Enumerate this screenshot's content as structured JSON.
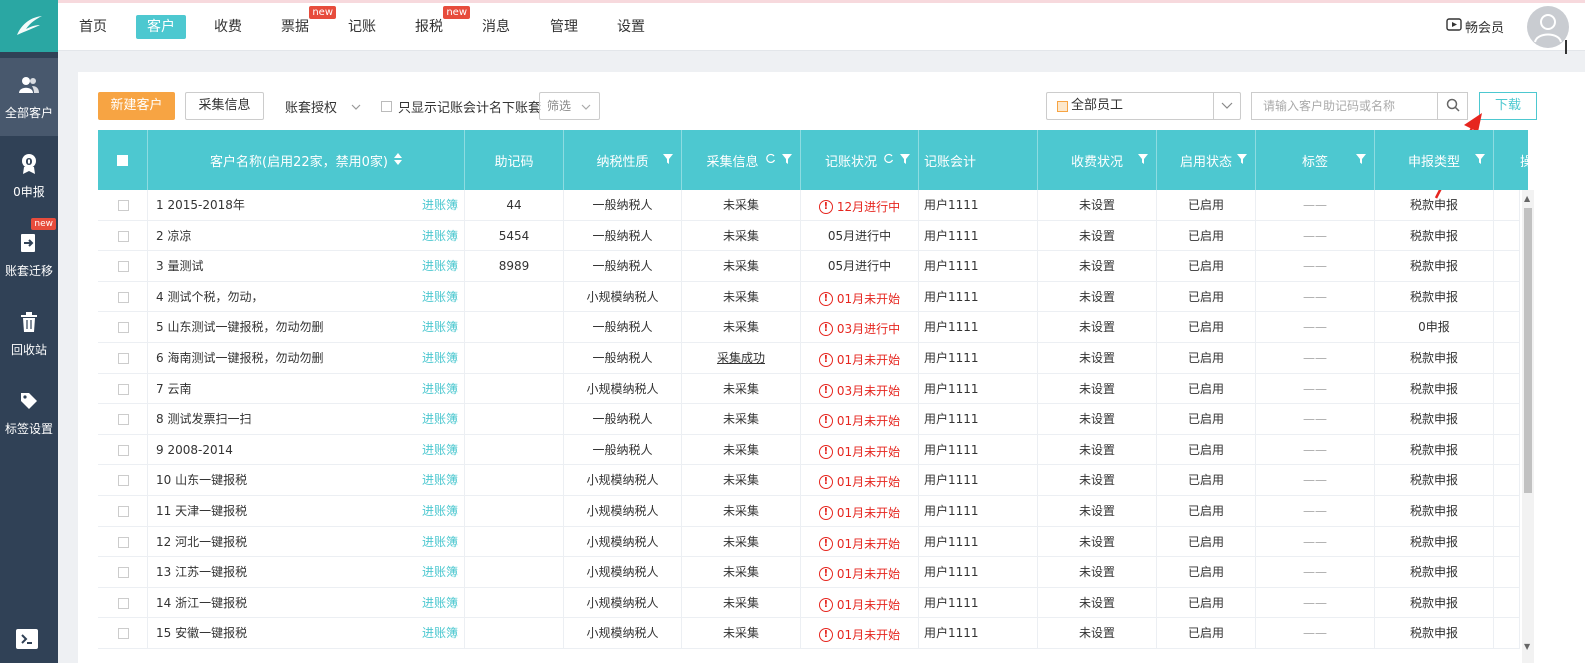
{
  "nav": {
    "items": [
      {
        "label": "首页",
        "active": false,
        "badge": ""
      },
      {
        "label": "客户",
        "active": true,
        "badge": ""
      },
      {
        "label": "收费",
        "active": false,
        "badge": ""
      },
      {
        "label": "票据",
        "active": false,
        "badge": "new"
      },
      {
        "label": "记账",
        "active": false,
        "badge": ""
      },
      {
        "label": "报税",
        "active": false,
        "badge": "new"
      },
      {
        "label": "消息",
        "active": false,
        "badge": ""
      },
      {
        "label": "管理",
        "active": false,
        "badge": ""
      },
      {
        "label": "设置",
        "active": false,
        "badge": ""
      }
    ],
    "vip_label": "畅会员"
  },
  "sidebar": {
    "items": [
      {
        "label": "全部客户",
        "icon": "users-icon",
        "active": true
      },
      {
        "label": "0申报",
        "icon": "zero-icon",
        "active": false
      },
      {
        "label": "账套迁移",
        "icon": "migrate-icon",
        "active": false,
        "badge": "new"
      },
      {
        "label": "回收站",
        "icon": "trash-icon",
        "active": false
      },
      {
        "label": "标签设置",
        "icon": "tag-icon",
        "active": false
      }
    ]
  },
  "toolbar": {
    "new_customer": "新建客户",
    "collect_info": "采集信息",
    "ledger_auth": "账套授权",
    "only_mine": "只显示记账会计名下账套",
    "filter": "筛选",
    "staff": "全部员工",
    "search_placeholder": "请输入客户助记码或名称",
    "download": "下载"
  },
  "table": {
    "headers": {
      "name": "客户名称(启用22家，禁用0家)",
      "memo": "助记码",
      "tax_type": "纳税性质",
      "collect": "采集信息",
      "booking": "记账状况",
      "accountant": "记账会计",
      "fee": "收费状况",
      "enabled": "启用状态",
      "tag": "标签",
      "declare": "申报类型",
      "ops": "操作"
    },
    "ledger_link": "进账簿",
    "rows": [
      {
        "name": "1 2015-2018年",
        "memo": "44",
        "tax": "一般纳税人",
        "collect": "未采集",
        "collect_link": false,
        "booking": "12月进行中",
        "warn": true,
        "accountant": "用户1111",
        "fee": "未设置",
        "enabled": "已启用",
        "tag": "——",
        "declare": "税款申报"
      },
      {
        "name": "2 凉凉",
        "memo": "5454",
        "tax": "一般纳税人",
        "collect": "未采集",
        "collect_link": false,
        "booking": "05月进行中",
        "warn": false,
        "accountant": "用户1111",
        "fee": "未设置",
        "enabled": "已启用",
        "tag": "——",
        "declare": "税款申报"
      },
      {
        "name": "3 量测试",
        "memo": "8989",
        "tax": "一般纳税人",
        "collect": "未采集",
        "collect_link": false,
        "booking": "05月进行中",
        "warn": false,
        "accountant": "用户1111",
        "fee": "未设置",
        "enabled": "已启用",
        "tag": "——",
        "declare": "税款申报"
      },
      {
        "name": "4 测试个税，勿动，",
        "memo": "",
        "tax": "小规模纳税人",
        "collect": "未采集",
        "collect_link": false,
        "booking": "01月未开始",
        "warn": true,
        "accountant": "用户1111",
        "fee": "未设置",
        "enabled": "已启用",
        "tag": "——",
        "declare": "税款申报"
      },
      {
        "name": "5 山东测试一键报税，勿动勿删",
        "memo": "",
        "tax": "一般纳税人",
        "collect": "未采集",
        "collect_link": false,
        "booking": "03月进行中",
        "warn": true,
        "accountant": "用户1111",
        "fee": "未设置",
        "enabled": "已启用",
        "tag": "——",
        "declare": "0申报"
      },
      {
        "name": "6 海南测试一键报税，勿动勿删",
        "memo": "",
        "tax": "一般纳税人",
        "collect": "采集成功",
        "collect_link": true,
        "booking": "01月未开始",
        "warn": true,
        "accountant": "用户1111",
        "fee": "未设置",
        "enabled": "已启用",
        "tag": "——",
        "declare": "税款申报"
      },
      {
        "name": "7 云南",
        "memo": "",
        "tax": "小规模纳税人",
        "collect": "未采集",
        "collect_link": false,
        "booking": "03月未开始",
        "warn": true,
        "accountant": "用户1111",
        "fee": "未设置",
        "enabled": "已启用",
        "tag": "——",
        "declare": "税款申报"
      },
      {
        "name": "8 测试发票扫一扫",
        "memo": "",
        "tax": "一般纳税人",
        "collect": "未采集",
        "collect_link": false,
        "booking": "01月未开始",
        "warn": true,
        "accountant": "用户1111",
        "fee": "未设置",
        "enabled": "已启用",
        "tag": "——",
        "declare": "税款申报"
      },
      {
        "name": "9 2008-2014",
        "memo": "",
        "tax": "一般纳税人",
        "collect": "未采集",
        "collect_link": false,
        "booking": "01月未开始",
        "warn": true,
        "accountant": "用户1111",
        "fee": "未设置",
        "enabled": "已启用",
        "tag": "——",
        "declare": "税款申报"
      },
      {
        "name": "10 山东一键报税",
        "memo": "",
        "tax": "小规模纳税人",
        "collect": "未采集",
        "collect_link": false,
        "booking": "01月未开始",
        "warn": true,
        "accountant": "用户1111",
        "fee": "未设置",
        "enabled": "已启用",
        "tag": "——",
        "declare": "税款申报"
      },
      {
        "name": "11 天津一键报税",
        "memo": "",
        "tax": "小规模纳税人",
        "collect": "未采集",
        "collect_link": false,
        "booking": "01月未开始",
        "warn": true,
        "accountant": "用户1111",
        "fee": "未设置",
        "enabled": "已启用",
        "tag": "——",
        "declare": "税款申报"
      },
      {
        "name": "12 河北一键报税",
        "memo": "",
        "tax": "小规模纳税人",
        "collect": "未采集",
        "collect_link": false,
        "booking": "01月未开始",
        "warn": true,
        "accountant": "用户1111",
        "fee": "未设置",
        "enabled": "已启用",
        "tag": "——",
        "declare": "税款申报"
      },
      {
        "name": "13 江苏一键报税",
        "memo": "",
        "tax": "小规模纳税人",
        "collect": "未采集",
        "collect_link": false,
        "booking": "01月未开始",
        "warn": true,
        "accountant": "用户1111",
        "fee": "未设置",
        "enabled": "已启用",
        "tag": "——",
        "declare": "税款申报"
      },
      {
        "name": "14 浙江一键报税",
        "memo": "",
        "tax": "小规模纳税人",
        "collect": "未采集",
        "collect_link": false,
        "booking": "01月未开始",
        "warn": true,
        "accountant": "用户1111",
        "fee": "未设置",
        "enabled": "已启用",
        "tag": "——",
        "declare": "税款申报"
      },
      {
        "name": "15 安徽一键报税",
        "memo": "",
        "tax": "小规模纳税人",
        "collect": "未采集",
        "collect_link": false,
        "booking": "01月未开始",
        "warn": true,
        "accountant": "用户1111",
        "fee": "未设置",
        "enabled": "已启用",
        "tag": "——",
        "declare": "税款申报"
      }
    ]
  },
  "colors": {
    "teal": "#4dc8d0",
    "orange": "#f7a443",
    "sidebar": "#304156",
    "red": "#e6261f"
  }
}
